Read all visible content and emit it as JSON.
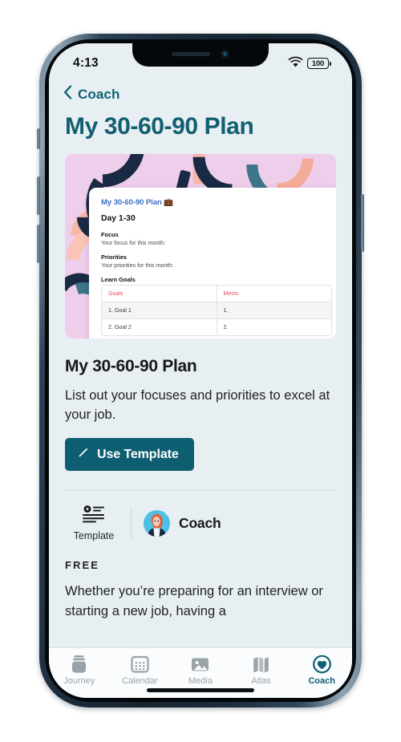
{
  "status_bar": {
    "time": "4:13",
    "wifi_icon": "wifi-icon",
    "battery_text": "100"
  },
  "nav": {
    "back_icon": "chevron-left-icon",
    "back_label": "Coach"
  },
  "header": {
    "title": "My 30-60-90 Plan",
    "title_color": "#115f70"
  },
  "preview_card": {
    "doc_title": "My 30-60-90 Plan 💼",
    "doc_heading": "Day 1-30",
    "sections": [
      {
        "heading": "Focus",
        "text": "Your focus for this month:"
      },
      {
        "heading": "Priorities",
        "text": "Your priorities for this month:"
      }
    ],
    "table_heading": "Learn Goals",
    "table": {
      "columns": [
        "Goals",
        "Metric"
      ],
      "rows": [
        [
          "1. Goal 1",
          "1."
        ],
        [
          "2. Goal 2",
          "2."
        ]
      ]
    },
    "bg_color": "#eeceea",
    "accent_navy": "#1b2a44",
    "accent_teal": "#3c7688",
    "accent_salmon": "#f4a391"
  },
  "main": {
    "title": "My 30-60-90 Plan",
    "description": "List out your focuses and priorities to excel at your job.",
    "use_template_label": "Use Template",
    "use_template_icon": "pencil-icon",
    "button_color": "#0d5e71"
  },
  "meta": {
    "template_icon": "template-list-icon",
    "template_label": "Template",
    "coach_avatar": "avatar-coach",
    "coach_name": "Coach"
  },
  "article": {
    "price_label": "FREE",
    "body": "Whether you’re preparing for an interview or starting a new job, having a"
  },
  "tabbar": {
    "items": [
      {
        "label": "Journey",
        "icon": "journey-jar-icon",
        "active": false
      },
      {
        "label": "Calendar",
        "icon": "calendar-icon",
        "active": false
      },
      {
        "label": "Media",
        "icon": "media-image-icon",
        "active": false
      },
      {
        "label": "Atlas",
        "icon": "map-icon",
        "active": false
      },
      {
        "label": "Coach",
        "icon": "heart-circle-icon",
        "active": true
      }
    ],
    "active_color": "#0d6173",
    "inactive_color": "#9aa3a8"
  }
}
